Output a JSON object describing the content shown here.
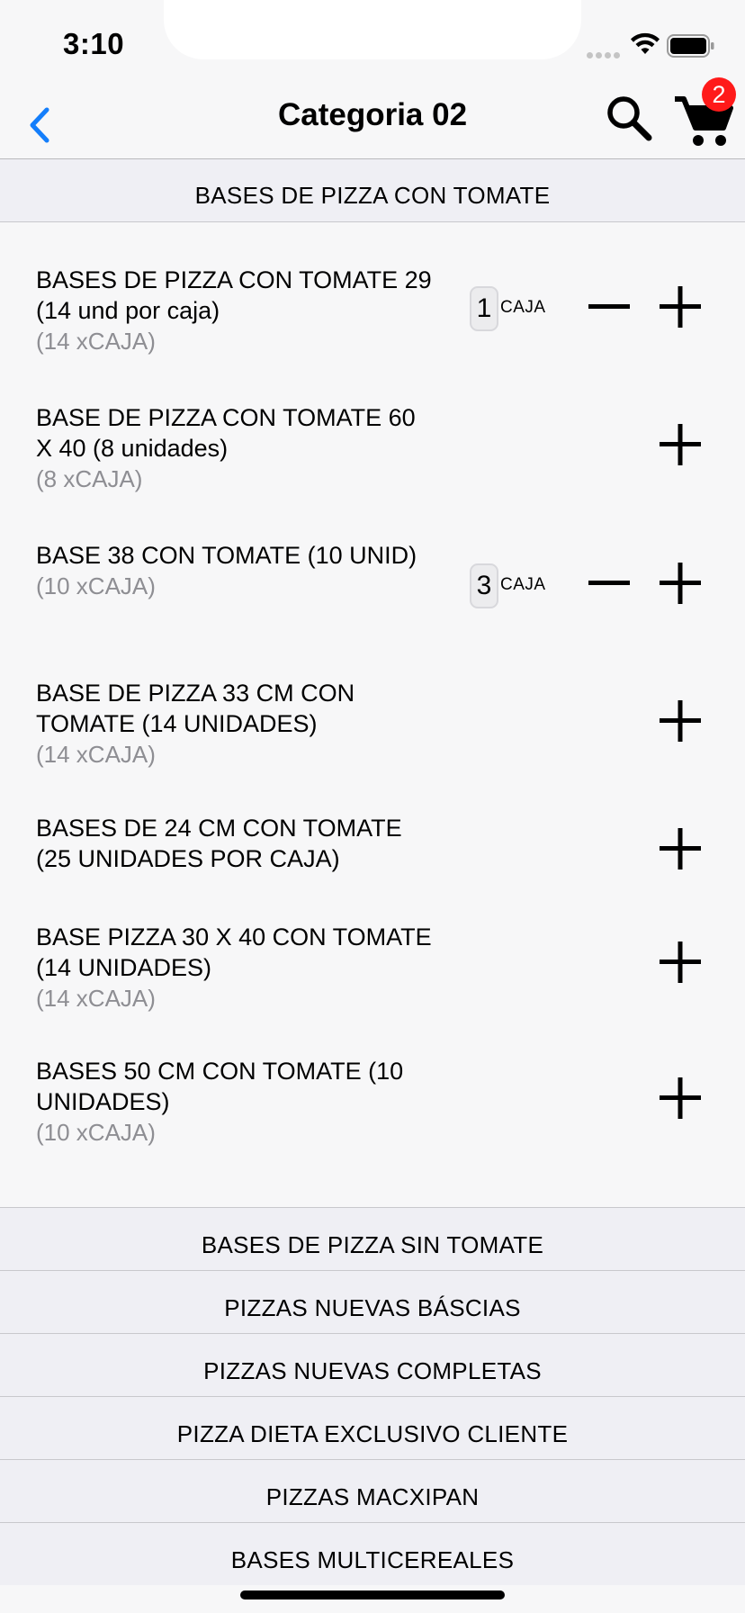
{
  "status_bar": {
    "time": "3:10"
  },
  "nav": {
    "title": "Categoria 02",
    "cart_count": "2"
  },
  "open_section": {
    "label": "BASES DE PIZZA CON TOMATE"
  },
  "products": [
    {
      "name": "BASES DE PIZZA CON TOMATE 29 (14 und por caja)",
      "pack": "(14 xCAJA)",
      "qty": "1",
      "unit": "CAJA"
    },
    {
      "name": "BASE DE PIZZA CON TOMATE 60 X 40 (8 unidades)",
      "pack": "(8 xCAJA)",
      "qty": "",
      "unit": ""
    },
    {
      "name": "BASE 38 CON TOMATE (10 UNID)",
      "pack": "(10 xCAJA)",
      "qty": "3",
      "unit": "CAJA"
    },
    {
      "name": "BASE DE PIZZA 33 CM CON TOMATE (14 UNIDADES)",
      "pack": "(14 xCAJA)",
      "qty": "",
      "unit": ""
    },
    {
      "name": "BASES DE 24 CM CON TOMATE (25 UNIDADES POR CAJA)",
      "pack": "",
      "qty": "",
      "unit": ""
    },
    {
      "name": "BASE PIZZA 30 X 40 CON TOMATE (14 UNIDADES)",
      "pack": "(14 xCAJA)",
      "qty": "",
      "unit": ""
    },
    {
      "name": "BASES 50 CM CON TOMATE (10 UNIDADES)",
      "pack": "(10 xCAJA)",
      "qty": "",
      "unit": ""
    }
  ],
  "collapsed_sections": [
    {
      "label": "BASES DE PIZZA SIN TOMATE"
    },
    {
      "label": "PIZZAS NUEVAS BÁSCIAS"
    },
    {
      "label": "PIZZAS NUEVAS COMPLETAS"
    },
    {
      "label": "PIZZA  DIETA EXCLUSIVO CLIENTE"
    },
    {
      "label": "PIZZAS MACXIPAN"
    },
    {
      "label": "BASES MULTICEREALES"
    }
  ],
  "colors": {
    "accent": "#147efb",
    "badge": "#ff1a1a",
    "secondary_text": "#8e8e93"
  },
  "icons": [
    "back-chevron-icon",
    "search-icon",
    "cart-icon",
    "minus-icon",
    "plus-icon",
    "wifi-icon",
    "battery-icon"
  ]
}
